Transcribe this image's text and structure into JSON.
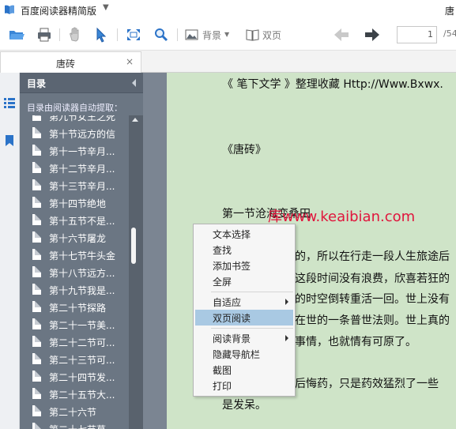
{
  "app": {
    "title": "百度阅读器精简版",
    "title_right": "唐"
  },
  "toolbar": {
    "background_label": "背景",
    "dual_page_label": "双页",
    "page_input_value": "1",
    "page_total": "/54"
  },
  "tab": {
    "label": "唐砖",
    "close": "×"
  },
  "sidebar": {
    "title": "目录",
    "note": "目录由阅读器自动提取：",
    "items": [
      {
        "label": "第九节女王之死"
      },
      {
        "label": "第十节远方的信"
      },
      {
        "label": "第十一节辛月..."
      },
      {
        "label": "第十二节辛月..."
      },
      {
        "label": "第十三节辛月..."
      },
      {
        "label": "第十四节绝地"
      },
      {
        "label": "第十五节不是..."
      },
      {
        "label": "第十六节屠龙"
      },
      {
        "label": "第十七节牛头金"
      },
      {
        "label": "第十八节远方..."
      },
      {
        "label": "第十九节我是..."
      },
      {
        "label": "第二十节探路"
      },
      {
        "label": "第二十一节美..."
      },
      {
        "label": "第二十二节可..."
      },
      {
        "label": "第二十三节可..."
      },
      {
        "label": "第二十四节发..."
      },
      {
        "label": "第二十五节大..."
      },
      {
        "label": "第二十六节"
      },
      {
        "label": "第二十七节草..."
      }
    ]
  },
  "page": {
    "lines": [
      "《 笔下文学 》整理收藏 Http://Www.Bxwx.",
      "《唐砖》",
      "第一节沧海变桑田",
      "的，所以在行走一段人生旅途后",
      "这段时间没有浪费，欣喜若狂的",
      "的时空倒转重活一回。世上没有",
      "在世的一条普世法则。世上真的",
      "事情，也就情有可原了。",
      "后悔药，只是药效猛烈了一些",
      "是发呆。"
    ],
    "watermark": "库www.keaibian.com"
  },
  "context_menu": {
    "items": [
      {
        "label": "文本选择"
      },
      {
        "label": "查找"
      },
      {
        "label": "添加书签"
      },
      {
        "label": "全屏"
      },
      {
        "label": "自适应"
      },
      {
        "label": "双页阅读"
      },
      {
        "label": "阅读背景"
      },
      {
        "label": "隐藏导航栏"
      },
      {
        "label": "截图"
      },
      {
        "label": "打印"
      }
    ]
  },
  "colors": {
    "page_background": "#cfe4c8",
    "sidebar_background": "#6b7683",
    "menu_highlight": "#a9c9e3",
    "watermark": "#e0153c",
    "accent_blue": "#2b73c8"
  },
  "icons": {
    "app_logo": "baidu-reader-logo-icon",
    "open": "folder-open-icon",
    "print": "printer-icon",
    "hand": "hand-icon",
    "select": "select-cursor-icon",
    "fit": "fit-screen-icon",
    "zoom": "zoom-icon",
    "background": "background-image-icon",
    "dual_page": "open-book-icon",
    "prev": "arrow-left-icon",
    "next": "arrow-right-icon",
    "toc": "list-icon",
    "bookmark": "bookmark-icon"
  }
}
